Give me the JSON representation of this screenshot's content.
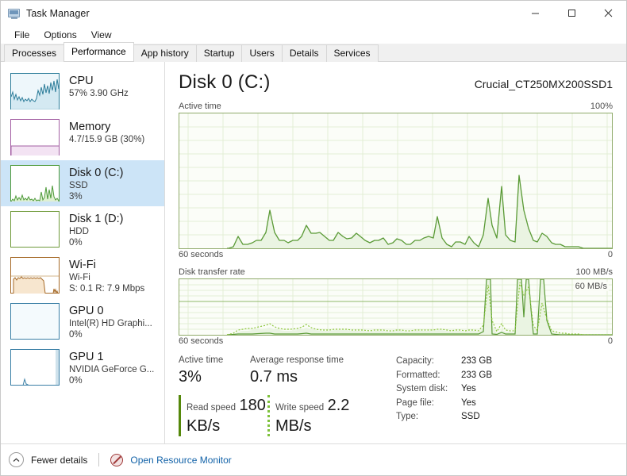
{
  "window": {
    "title": "Task Manager",
    "icon": "task-manager-icon",
    "minimize": "–",
    "maximize": "□",
    "close": "✕"
  },
  "menubar": {
    "items": [
      {
        "label": "File"
      },
      {
        "label": "Options"
      },
      {
        "label": "View"
      }
    ]
  },
  "tabs": [
    {
      "label": "Processes",
      "active": false
    },
    {
      "label": "Performance",
      "active": true
    },
    {
      "label": "App history",
      "active": false
    },
    {
      "label": "Startup",
      "active": false
    },
    {
      "label": "Users",
      "active": false
    },
    {
      "label": "Details",
      "active": false
    },
    {
      "label": "Services",
      "active": false
    }
  ],
  "sidebar": {
    "items": [
      {
        "name": "CPU",
        "line2": "57%  3.90 GHz",
        "line3": "",
        "selected": false,
        "color": "#2d7d9a"
      },
      {
        "name": "Memory",
        "line2": "4.7/15.9 GB (30%)",
        "line3": "",
        "selected": false,
        "color": "#a35fa3"
      },
      {
        "name": "Disk 0 (C:)",
        "line2": "SSD",
        "line3": "3%",
        "selected": true,
        "color": "#4e9a3a"
      },
      {
        "name": "Disk 1 (D:)",
        "line2": "HDD",
        "line3": "0%",
        "selected": false,
        "color": "#6f9a3a"
      },
      {
        "name": "Wi-Fi",
        "line2": "Wi-Fi",
        "line3": "S: 0.1 R: 7.9 Mbps",
        "selected": false,
        "color": "#a66a28"
      },
      {
        "name": "GPU 0",
        "line2": "Intel(R) HD Graphi...",
        "line3": "0%",
        "selected": false,
        "color": "#3a7fa6"
      },
      {
        "name": "GPU 1",
        "line2": "NVIDIA GeForce G...",
        "line3": "0%",
        "selected": false,
        "color": "#3a7fa6"
      }
    ]
  },
  "main": {
    "title": "Disk 0 (C:)",
    "model": "Crucial_CT250MX200SSD1",
    "active_graph": {
      "label": "Active time",
      "max_label": "100%",
      "left_axis": "60 seconds",
      "right_axis": "0"
    },
    "transfer_graph": {
      "label": "Disk transfer rate",
      "max_label": "100 MB/s",
      "inner_label": "60 MB/s",
      "left_axis": "60 seconds",
      "right_axis": "0"
    },
    "stats": {
      "active_time_label": "Active time",
      "active_time_value": "3%",
      "avg_response_label": "Average response time",
      "avg_response_value": "0.7 ms",
      "read_speed_label": "Read speed",
      "read_speed_value": "180 KB/s",
      "write_speed_label": "Write speed",
      "write_speed_value": "2.2 MB/s"
    },
    "info": [
      {
        "key": "Capacity:",
        "value": "233 GB"
      },
      {
        "key": "Formatted:",
        "value": "233 GB"
      },
      {
        "key": "System disk:",
        "value": "Yes"
      },
      {
        "key": "Page file:",
        "value": "Yes"
      },
      {
        "key": "Type:",
        "value": "SSD"
      }
    ]
  },
  "footer": {
    "fewer_details": "Fewer details",
    "open_resource_monitor": "Open Resource Monitor"
  },
  "colors": {
    "disk_line": "#4e9a3a",
    "disk_fill": "#eaf4e2",
    "grid": "#d7e6c7",
    "border": "#8faa6a",
    "selection": "#cce4f7",
    "link": "#1262a8"
  },
  "chart_data": [
    {
      "type": "area",
      "title": "Active time",
      "ylabel": "%",
      "xlabel": "seconds",
      "ylim": [
        0,
        100
      ],
      "xlim": [
        60,
        0
      ],
      "grid": true,
      "values": [
        0,
        0,
        0,
        0,
        0,
        0,
        0,
        0,
        0,
        0,
        0,
        0,
        0,
        0,
        0,
        0,
        0,
        1,
        9,
        3,
        3,
        4,
        5,
        6,
        8,
        12,
        28,
        12,
        6,
        6,
        4,
        5,
        5,
        7,
        17,
        11,
        11,
        12,
        9,
        5,
        5,
        12,
        9,
        8,
        11,
        14,
        6,
        13,
        12,
        10,
        5,
        3,
        4,
        9,
        8,
        6,
        3,
        4,
        6,
        2,
        2,
        6,
        6,
        4,
        5,
        6,
        7,
        6,
        24,
        8,
        2,
        1,
        3,
        3,
        2,
        8,
        3,
        1,
        10,
        37,
        17,
        6,
        46,
        10,
        7,
        6,
        54,
        28,
        16,
        6,
        5,
        11,
        9,
        4,
        3,
        3
      ]
    },
    {
      "type": "line",
      "title": "Disk transfer rate",
      "ylabel": "MB/s",
      "xlabel": "seconds",
      "ylim": [
        0,
        100
      ],
      "xlim": [
        60,
        0
      ],
      "grid": true,
      "reference_line": 60,
      "series": [
        {
          "name": "Read",
          "style": "solid",
          "values": [
            0,
            0,
            0,
            0,
            0,
            0,
            0,
            0,
            0,
            0,
            0,
            0,
            0,
            0,
            0,
            0,
            0,
            0,
            1,
            1,
            1,
            1,
            1,
            1,
            1,
            1,
            2,
            1,
            1,
            1,
            1,
            1,
            1,
            1,
            2,
            1,
            1,
            1,
            1,
            1,
            1,
            1,
            1,
            1,
            1,
            1,
            1,
            1,
            1,
            1,
            1,
            1,
            1,
            1,
            1,
            1,
            1,
            1,
            1,
            1,
            1,
            1,
            1,
            1,
            1,
            1,
            1,
            1,
            2,
            1,
            1,
            1,
            1,
            1,
            1,
            1,
            1,
            1,
            6,
            100,
            2,
            1,
            4,
            2,
            2,
            1,
            100,
            30,
            45,
            2,
            1,
            28,
            18,
            2,
            1,
            1
          ]
        },
        {
          "name": "Write",
          "style": "dotted",
          "values": [
            0,
            0,
            0,
            0,
            0,
            0,
            0,
            0,
            0,
            0,
            0,
            0,
            0,
            0,
            0,
            0,
            0,
            0,
            5,
            6,
            6,
            7,
            8,
            9,
            10,
            11,
            13,
            9,
            7,
            7,
            6,
            6,
            6,
            7,
            12,
            9,
            8,
            8,
            7,
            6,
            6,
            8,
            8,
            7,
            8,
            9,
            6,
            8,
            8,
            8,
            6,
            5,
            5,
            7,
            7,
            6,
            5,
            5,
            6,
            4,
            4,
            6,
            6,
            5,
            5,
            6,
            6,
            6,
            9,
            6,
            4,
            4,
            5,
            5,
            4,
            6,
            5,
            4,
            8,
            90,
            12,
            6,
            20,
            8,
            6,
            6,
            95,
            70,
            86,
            40,
            5,
            70,
            62,
            10,
            4,
            3
          ]
        }
      ]
    }
  ]
}
